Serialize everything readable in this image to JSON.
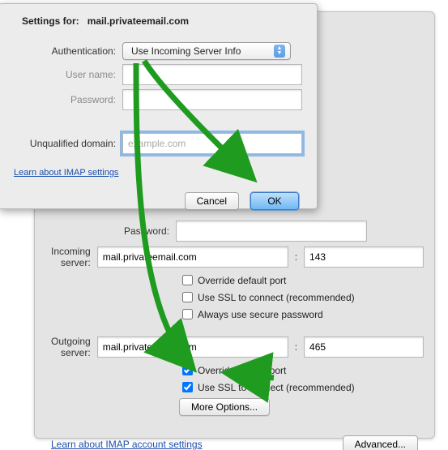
{
  "sheet": {
    "title_prefix": "Settings for:",
    "title_server": "mail.privateemail.com",
    "auth_label": "Authentication:",
    "auth_value": "Use Incoming Server Info",
    "username_label": "User name:",
    "username_value": "",
    "password_label": "Password:",
    "password_value": "",
    "domain_label": "Unqualified domain:",
    "domain_placeholder": "example.com",
    "domain_value": "",
    "imap_link": "Learn about IMAP settings",
    "cancel": "Cancel",
    "ok": "OK"
  },
  "main": {
    "password_label": "Password:",
    "password_value": "",
    "incoming_label": "Incoming server:",
    "incoming_value": "mail.privateemail.com",
    "incoming_port": "143",
    "incoming_checks": {
      "override": {
        "checked": false,
        "label": "Override default port"
      },
      "ssl": {
        "checked": false,
        "label": "Use SSL to connect (recommended)"
      },
      "secure": {
        "checked": false,
        "label": "Always use secure password"
      }
    },
    "outgoing_label": "Outgoing server:",
    "outgoing_value": "mail.privateemail.com",
    "outgoing_port": "465",
    "outgoing_checks": {
      "override": {
        "checked": true,
        "label": "Override default port"
      },
      "ssl": {
        "checked": true,
        "label": "Use SSL to connect (recommended)"
      }
    },
    "more_options": "More Options...",
    "imap_account_link": "Learn about IMAP account settings",
    "advanced": "Advanced..."
  },
  "arrow_color": "#1f9b1f"
}
